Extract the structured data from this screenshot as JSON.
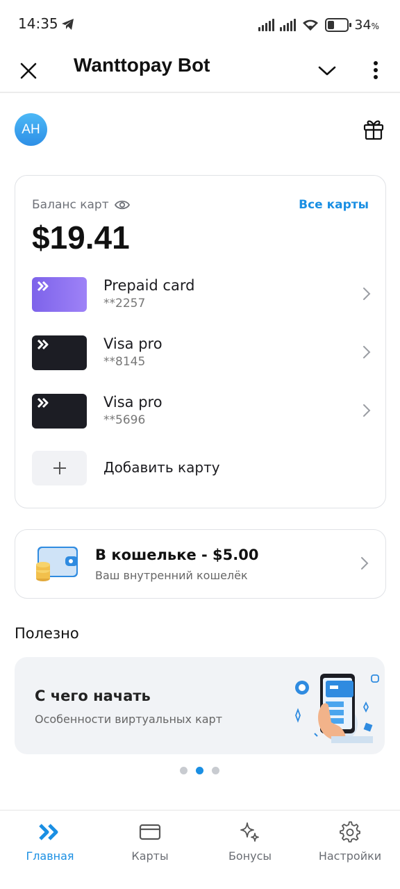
{
  "status_bar": {
    "time": "14:35",
    "battery_percent": "34",
    "battery_unit": "%",
    "battery_level": 0.34
  },
  "header": {
    "title": "Wanttopay Bot"
  },
  "profile": {
    "avatar_initials": "AH"
  },
  "balance": {
    "label": "Баланс карт",
    "all_cards_link": "Все карты",
    "amount": "$19.41"
  },
  "cards": [
    {
      "name": "Prepaid card",
      "number": "**2257",
      "style": "purple"
    },
    {
      "name": "Visa pro",
      "number": "**8145",
      "style": "dark"
    },
    {
      "name": "Visa pro",
      "number": "**5696",
      "style": "dark"
    }
  ],
  "add_card": {
    "label": "Добавить карту"
  },
  "wallet": {
    "title": "В кошельке - $5.00",
    "subtitle": "Ваш внутренний кошелёк"
  },
  "useful": {
    "section_title": "Полезно",
    "promo_title": "С чего начать",
    "promo_subtitle": "Особенности виртуальных карт",
    "pager_count": 3,
    "pager_active": 1
  },
  "bottom_nav": [
    {
      "label": "Главная",
      "icon": "home-chevrons-icon",
      "active": true
    },
    {
      "label": "Карты",
      "icon": "card-icon",
      "active": false
    },
    {
      "label": "Бонусы",
      "icon": "sparkles-icon",
      "active": false
    },
    {
      "label": "Настройки",
      "icon": "gear-icon",
      "active": false
    }
  ],
  "colors": {
    "accent": "#1a8fe3",
    "purple_card": "#8a6ff0",
    "dark_card": "#1c1d24"
  }
}
